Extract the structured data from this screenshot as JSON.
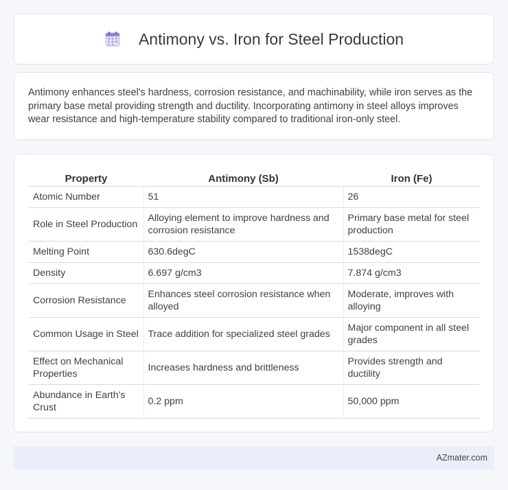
{
  "header": {
    "icon": "calendar-icon",
    "title": "Antimony vs. Iron for Steel Production"
  },
  "intro": {
    "text": "Antimony enhances steel's hardness, corrosion resistance, and machinability, while iron serves as the primary base metal providing strength and ductility. Incorporating antimony in steel alloys improves wear resistance and high-temperature stability compared to traditional iron-only steel."
  },
  "table": {
    "headers": [
      "Property",
      "Antimony (Sb)",
      "Iron (Fe)"
    ],
    "rows": [
      [
        "Atomic Number",
        "51",
        "26"
      ],
      [
        "Role in Steel Production",
        "Alloying element to improve hardness and corrosion resistance",
        "Primary base metal for steel production"
      ],
      [
        "Melting Point",
        "630.6degC",
        "1538degC"
      ],
      [
        "Density",
        "6.697 g/cm3",
        "7.874 g/cm3"
      ],
      [
        "Corrosion Resistance",
        "Enhances steel corrosion resistance when alloyed",
        "Moderate, improves with alloying"
      ],
      [
        "Common Usage in Steel",
        "Trace addition for specialized steel grades",
        "Major component in all steel grades"
      ],
      [
        "Effect on Mechanical Properties",
        "Increases hardness and brittleness",
        "Provides strength and ductility"
      ],
      [
        "Abundance in Earth's Crust",
        "0.2 ppm",
        "50,000 ppm"
      ]
    ]
  },
  "footer": {
    "brand": "AZmater.com"
  }
}
